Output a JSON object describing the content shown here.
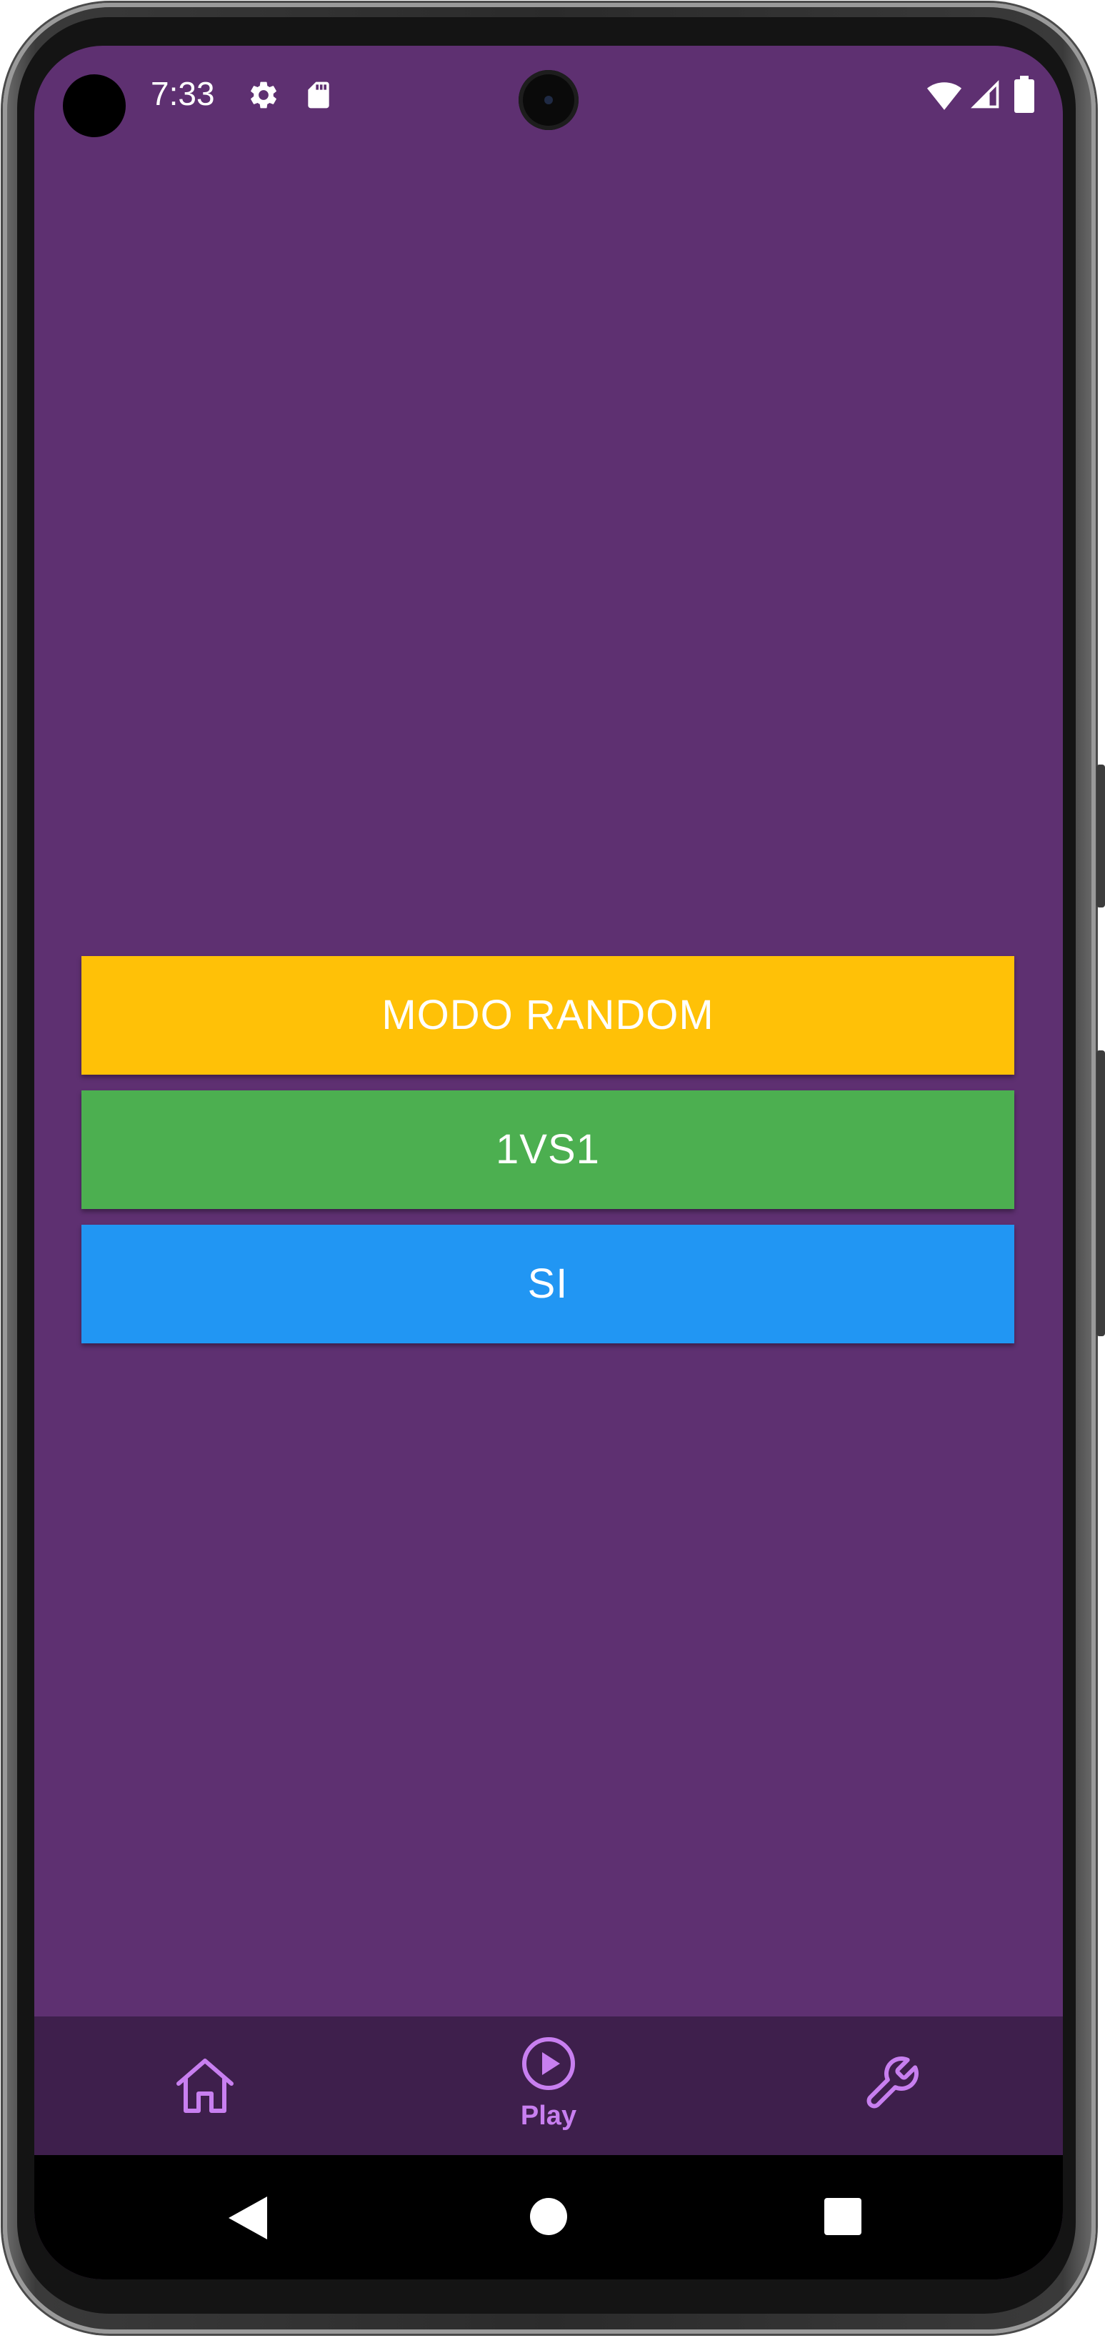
{
  "status_bar": {
    "time": "7:33",
    "left_icons": [
      "gear-icon",
      "sd-card-icon"
    ],
    "right_icons": [
      "wifi-icon",
      "cellular-signal-icon",
      "battery-icon"
    ]
  },
  "main": {
    "buttons": [
      {
        "label": "MODO RANDOM",
        "color": "#ffc107"
      },
      {
        "label": "1VS1",
        "color": "#4caf50"
      },
      {
        "label": "SI",
        "color": "#2196f3"
      }
    ]
  },
  "bottom_nav": {
    "items": [
      {
        "icon": "home-icon",
        "label": ""
      },
      {
        "icon": "play-circle-icon",
        "label": "Play",
        "selected": true
      },
      {
        "icon": "wrench-icon",
        "label": ""
      }
    ]
  },
  "system_nav": {
    "icons": [
      "back-icon",
      "home-circle-icon",
      "recents-icon"
    ]
  },
  "colors": {
    "background": "#5e3071",
    "nav_background": "#3e1f4c",
    "nav_accent": "#c87ff0"
  }
}
